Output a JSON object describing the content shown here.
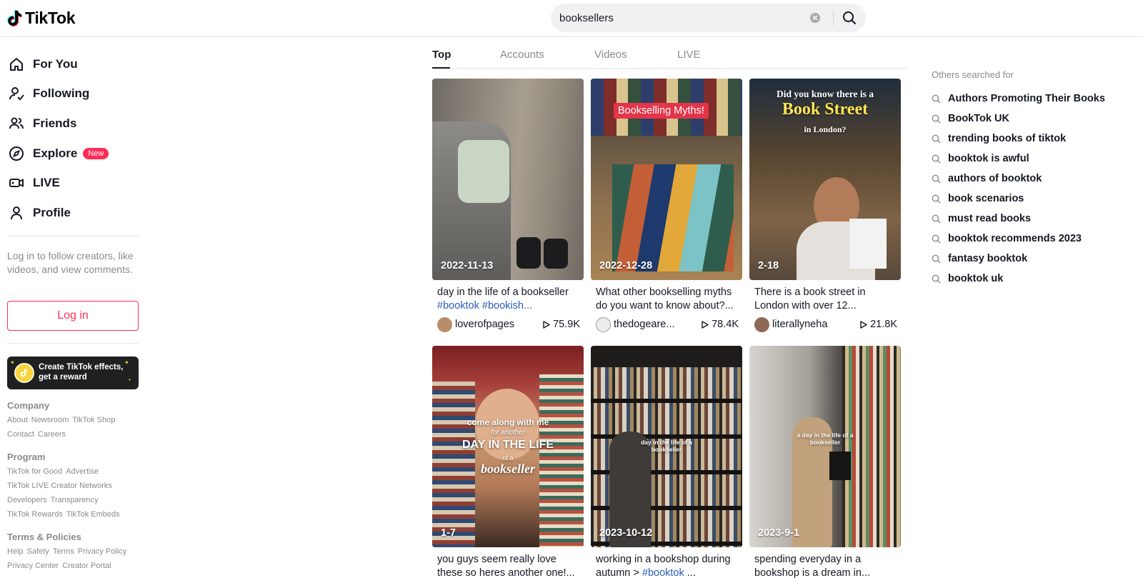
{
  "header": {
    "logo_text": "TikTok",
    "search_value": "booksellers",
    "search_placeholder": "Search"
  },
  "sidebar": {
    "nav": [
      {
        "label": "For You",
        "icon": "home-icon"
      },
      {
        "label": "Following",
        "icon": "following-icon"
      },
      {
        "label": "Friends",
        "icon": "friends-icon"
      },
      {
        "label": "Explore",
        "icon": "compass-icon",
        "badge": "New"
      },
      {
        "label": "LIVE",
        "icon": "live-icon"
      },
      {
        "label": "Profile",
        "icon": "profile-icon"
      }
    ],
    "login_prompt": "Log in to follow creators, like videos, and view comments.",
    "login_button": "Log in",
    "effects_line1": "Create TikTok effects,",
    "effects_line2": "get a reward",
    "footer": {
      "company_head": "Company",
      "company_links": [
        "About",
        "Newsroom",
        "TikTok Shop",
        "Contact",
        "Careers"
      ],
      "program_head": "Program",
      "program_links": [
        "TikTok for Good",
        "Advertise",
        "TikTok LIVE Creator Networks",
        "Developers",
        "Transparency",
        "TikTok Rewards",
        "TikTok Embeds"
      ],
      "terms_head": "Terms & Policies",
      "terms_links": [
        "Help",
        "Safety",
        "Terms",
        "Privacy Policy",
        "Privacy Center",
        "Creator Portal"
      ]
    }
  },
  "tabs": [
    "Top",
    "Accounts",
    "Videos",
    "LIVE"
  ],
  "active_tab": "Top",
  "videos": [
    {
      "date": "2022-11-13",
      "desc": "day in the life of a bookseller",
      "tags": "#booktok #bookish...",
      "author": "loverofpages",
      "views": "75.9K"
    },
    {
      "date": "2022-12-28",
      "overlay": "Bookselling Myths!",
      "desc": "What other bookselling myths do you want to know about?...",
      "author": "thedogeare...",
      "views": "78.4K"
    },
    {
      "date": "2-18",
      "overlay_line1": "Did you know there is a",
      "overlay_line2": "Book Street",
      "overlay_line3": "in London?",
      "desc": "There is a book street in London with over 12...",
      "author": "literallyneha",
      "views": "21.8K"
    },
    {
      "date": "1-7",
      "overlay_line1": "come along with me",
      "overlay_line2": "for another",
      "overlay_line3": "DAY IN THE LIFE",
      "overlay_line4": "of a",
      "overlay_line5": "bookseller",
      "desc": "you guys seem really love these so heres another one!..."
    },
    {
      "date": "2023-10-12",
      "overlay_line1": "day in the life of a",
      "overlay_line2": "bookseller",
      "desc_prefix": "working in a bookshop during autumn > ",
      "desc_tag": "#booktok",
      "desc_suffix": " ..."
    },
    {
      "date": "2023-9-1",
      "overlay_line1": "a day in the life of a",
      "overlay_line2": "bookseller",
      "desc": "spending everyday in a bookshop is a dream in..."
    }
  ],
  "others_searched": {
    "heading": "Others searched for",
    "items": [
      "Authors Promoting Their Books",
      "BookTok UK",
      "trending books of tiktok",
      "booktok is awful",
      "authors of booktok",
      "book scenarios",
      "must read books",
      "booktok recommends 2023",
      "fantasy booktok",
      "booktok uk"
    ]
  },
  "colors": {
    "accent": "#fe2c55",
    "text": "#161823",
    "muted": "#8a8b91",
    "link": "#2b5db9"
  }
}
